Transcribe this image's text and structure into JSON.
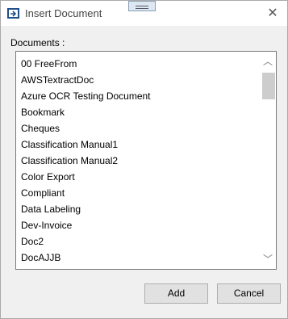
{
  "window": {
    "title": "Insert Document",
    "close_glyph": "✕"
  },
  "documents_label": "Documents :",
  "documents": [
    "00 FreeFrom",
    "AWSTextractDoc",
    "Azure OCR Testing Document",
    "Bookmark",
    "Cheques",
    "Classification Manual1",
    "Classification Manual2",
    "Color Export",
    "Compliant",
    "Data Labeling",
    "Dev-Invoice",
    "Doc2",
    "DocAJJB"
  ],
  "scrollbar": {
    "up_glyph": "︿",
    "down_glyph": "﹀"
  },
  "buttons": {
    "add": "Add",
    "cancel": "Cancel"
  },
  "icons": {
    "title": "insert-document-icon",
    "close": "close-icon",
    "grip": "drag-grip-icon"
  }
}
